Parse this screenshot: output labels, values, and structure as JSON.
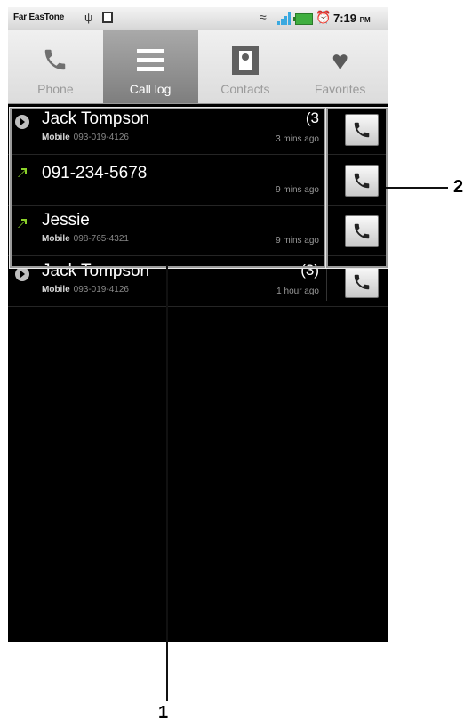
{
  "status_bar": {
    "carrier": "Far EasTone",
    "time": "7:19",
    "ampm": "PM"
  },
  "tabs": [
    {
      "label": "Phone",
      "icon": "phone-icon",
      "active": false
    },
    {
      "label": "Call log",
      "icon": "call-log-icon",
      "active": true
    },
    {
      "label": "Contacts",
      "icon": "contacts-icon",
      "active": false
    },
    {
      "label": "Favorites",
      "icon": "favorites-heart-icon",
      "active": false
    }
  ],
  "calls": [
    {
      "name": "Jack Tompson",
      "type": "missed",
      "number_type": "Mobile",
      "number": "093-019-4126",
      "count": "(3",
      "time": "3 mins ago"
    },
    {
      "name": "091-234-5678",
      "type": "outgoing",
      "number_type": "",
      "number": "",
      "count": "",
      "time": "9 mins ago"
    },
    {
      "name": "Jessie",
      "type": "outgoing",
      "number_type": "Mobile",
      "number": "098-765-4321",
      "count": "",
      "time": "9 mins ago"
    },
    {
      "name": "Jack Tompson",
      "type": "missed",
      "number_type": "Mobile",
      "number": "093-019-4126",
      "count": "(3)",
      "time": "1 hour ago"
    }
  ],
  "callouts": {
    "one": "1",
    "two": "2"
  },
  "colors": {
    "screen_bg": "#000000",
    "active_tab": "#8a8a8a",
    "outgoing_arrow": "#8bd22a",
    "missed_icon": "#bfbfbf"
  }
}
